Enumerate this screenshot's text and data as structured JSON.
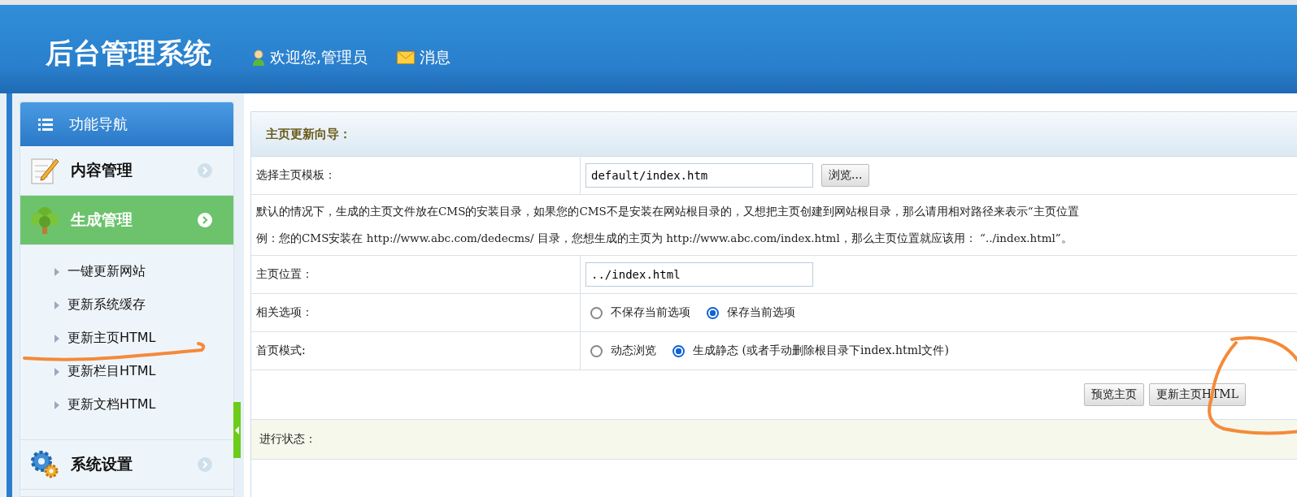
{
  "header": {
    "title": "后台管理系统",
    "user": "欢迎您,管理员",
    "messages": "消息"
  },
  "sidebar": {
    "title": "功能导航",
    "sections": [
      {
        "label": "内容管理",
        "selected": false
      },
      {
        "label": "生成管理",
        "selected": true,
        "children": [
          "一键更新网站",
          "更新系统缓存",
          "更新主页HTML",
          "更新栏目HTML",
          "更新文档HTML"
        ]
      },
      {
        "label": "系统设置",
        "selected": false
      }
    ]
  },
  "panel": {
    "title": "主页更新向导：",
    "rows": [
      {
        "kind": "input",
        "label": "选择主页模板：",
        "value": "default/index.htm",
        "button": "浏览..."
      },
      {
        "kind": "note",
        "lines": [
          "默认的情况下，生成的主页文件放在CMS的安装目录，如果您的CMS不是安装在网站根目录的，又想把主页创建到网站根目录，那么请用相对路径来表示“主页位置",
          "例：您的CMS安装在 http://www.abc.com/dedecms/ 目录，您想生成的主页为 http://www.abc.com/index.html，那么主页位置就应该用： “../index.html”。"
        ]
      },
      {
        "kind": "input",
        "label": "主页位置：",
        "value": "../index.html"
      },
      {
        "kind": "radio",
        "label": "相关选项：",
        "options": [
          {
            "label": "不保存当前选项",
            "selected": false
          },
          {
            "label": "保存当前选项",
            "selected": true
          }
        ]
      },
      {
        "kind": "radio",
        "label": "首页模式:",
        "options": [
          {
            "label": "动态浏览",
            "selected": false
          },
          {
            "label": "生成静态 (或者手动删除根目录下index.html文件)",
            "selected": true
          }
        ]
      }
    ],
    "buttons": [
      "预览主页",
      "更新主页HTML"
    ],
    "status_label": "进行状态："
  }
}
